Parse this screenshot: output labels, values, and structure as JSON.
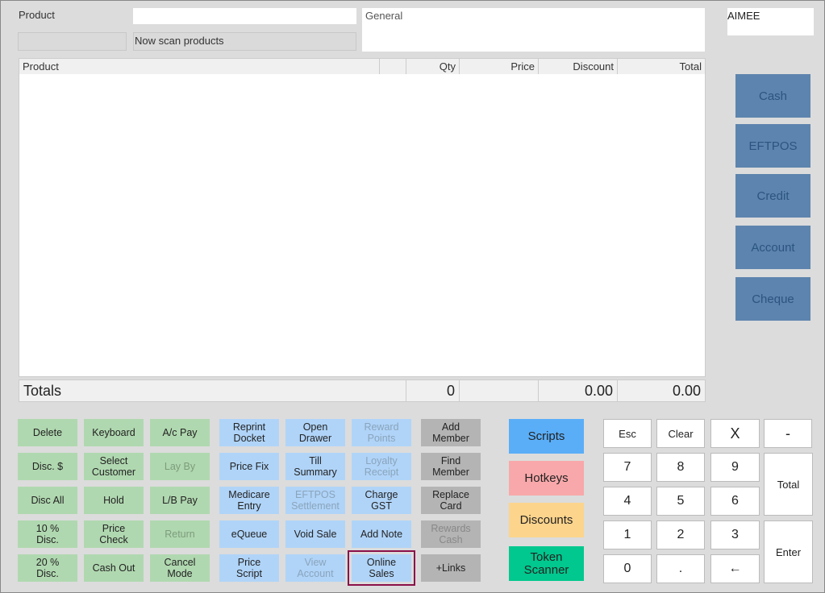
{
  "header": {
    "product_label": "Product",
    "product_value": "",
    "status": "Now scan products",
    "left_status": "",
    "customer": "General",
    "operator": "AIMEE"
  },
  "table": {
    "columns": [
      "Product",
      "",
      "Qty",
      "Price",
      "Discount",
      "Total"
    ],
    "totals_label": "Totals",
    "totals": {
      "qty": "0",
      "price": "",
      "discount": "0.00",
      "total": "0.00"
    }
  },
  "payments": [
    "Cash",
    "EFTPOS",
    "Credit",
    "Account",
    "Cheque"
  ],
  "buttons": [
    [
      "Delete",
      "Keyboard",
      "A/c Pay",
      "Reprint Docket",
      "Open Drawer",
      "Reward Points",
      "Add Member"
    ],
    [
      "Disc. $",
      "Select Customer",
      "Lay By",
      "Price Fix",
      "Till Summary",
      "Loyalty Receipt",
      "Find Member"
    ],
    [
      "Disc All",
      "Hold",
      "L/B Pay",
      "Medicare Entry",
      "EFTPOS Settlement",
      "Charge GST",
      "Replace Card"
    ],
    [
      "10 % Disc.",
      "Price Check",
      "Return",
      "eQueue",
      "Void Sale",
      "Add Note",
      "Rewards Cash"
    ],
    [
      "20 % Disc.",
      "Cash Out",
      "Cancel Mode",
      "Price Script",
      "View Account",
      "Online Sales",
      "+Links"
    ]
  ],
  "disabled": [
    "Lay By",
    "Return",
    "Reward Points",
    "Loyalty Receipt",
    "EFTPOS Settlement",
    "View Account",
    "Rewards Cash"
  ],
  "highlighted": "Online Sales",
  "big_buttons": [
    {
      "label": "Scripts",
      "color": "#5aaef8"
    },
    {
      "label": "Hotkeys",
      "color": "#f8a8aa"
    },
    {
      "label": "Discounts",
      "color": "#fcd48c"
    },
    {
      "label": "Token Scanner",
      "color": "#00c88e"
    }
  ],
  "keypad": {
    "rows": [
      [
        "Esc",
        "Clear",
        "X",
        "-"
      ],
      [
        "7",
        "8",
        "9"
      ],
      [
        "4",
        "5",
        "6"
      ],
      [
        "1",
        "2",
        "3"
      ],
      [
        "0",
        ".",
        "←"
      ]
    ],
    "total": "Total",
    "enter": "Enter"
  }
}
